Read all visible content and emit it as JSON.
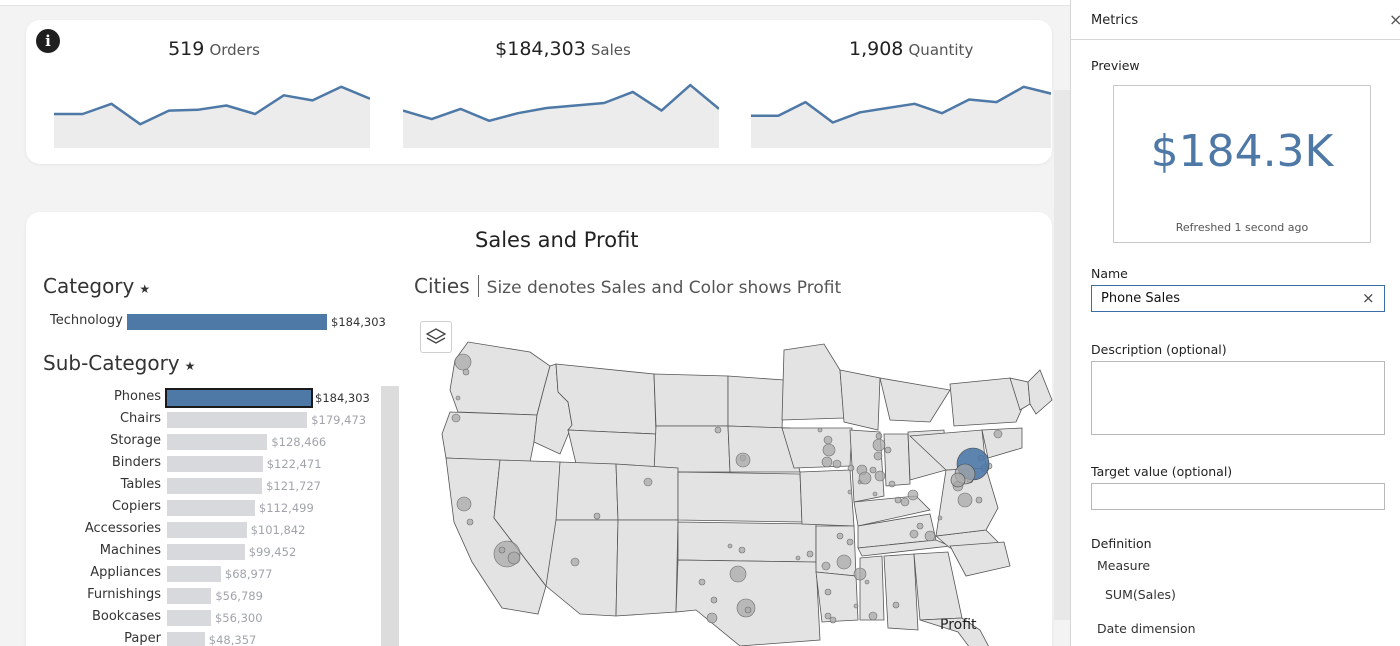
{
  "kpis": [
    {
      "value": "519",
      "unit": "Orders",
      "trend": [
        40,
        40,
        52,
        28,
        44,
        45,
        50,
        40,
        62,
        56,
        72,
        58
      ]
    },
    {
      "value": "$184,303",
      "unit": "Sales",
      "trend": [
        44,
        34,
        46,
        32,
        41,
        47,
        50,
        53,
        66,
        44,
        74,
        46
      ]
    },
    {
      "value": "1,908",
      "unit": "Quantity",
      "trend": [
        38,
        38,
        54,
        30,
        42,
        47,
        52,
        41,
        57,
        54,
        72,
        64
      ]
    }
  ],
  "dashboard": {
    "info_icon": "info-icon",
    "title": "Sales and Profit",
    "category_title": "Category",
    "subcategory_title": "Sub-Category",
    "star": "★",
    "cities_title": "Cities",
    "cities_subtitle": "Size denotes Sales and Color shows Profit",
    "layers_icon": "layers-icon",
    "legend_title": "Profit"
  },
  "category_bars": [
    {
      "label": "Technology",
      "value": 184303,
      "display": "$184,303"
    }
  ],
  "subcategory_bars": [
    {
      "label": "Phones",
      "value": 184303,
      "display": "$184,303",
      "selected": true
    },
    {
      "label": "Chairs",
      "value": 179473,
      "display": "$179,473"
    },
    {
      "label": "Storage",
      "value": 128466,
      "display": "$128,466"
    },
    {
      "label": "Binders",
      "value": 122471,
      "display": "$122,471"
    },
    {
      "label": "Tables",
      "value": 121727,
      "display": "$121,727"
    },
    {
      "label": "Copiers",
      "value": 112499,
      "display": "$112,499"
    },
    {
      "label": "Accessories",
      "value": 101842,
      "display": "$101,842"
    },
    {
      "label": "Machines",
      "value": 99452,
      "display": "$99,452"
    },
    {
      "label": "Appliances",
      "value": 68977,
      "display": "$68,977"
    },
    {
      "label": "Furnishings",
      "value": 56789,
      "display": "$56,789"
    },
    {
      "label": "Bookcases",
      "value": 56300,
      "display": "$56,300"
    },
    {
      "label": "Paper",
      "value": 48357,
      "display": "$48,357"
    }
  ],
  "colors": {
    "accent": "#4e79a7",
    "bar_inactive": "#d7d9dd",
    "value_inactive": "#a0a4aa",
    "map_fill": "#e3e3e3",
    "map_border": "#555555",
    "circle": "#a9a9a9"
  },
  "panel": {
    "title": "Metrics",
    "close_icon": "close-icon",
    "preview_label": "Preview",
    "preview_value": "$184.3K",
    "refreshed": "Refreshed 1 second ago",
    "name_label": "Name",
    "name_value": "Phone Sales",
    "clear_icon": "clear-icon",
    "description_label": "Description (optional)",
    "target_label": "Target value (optional)",
    "definition_label": "Definition",
    "measure_label": "Measure",
    "measure_value": "SUM(Sales)",
    "date_dimension_label": "Date dimension"
  }
}
